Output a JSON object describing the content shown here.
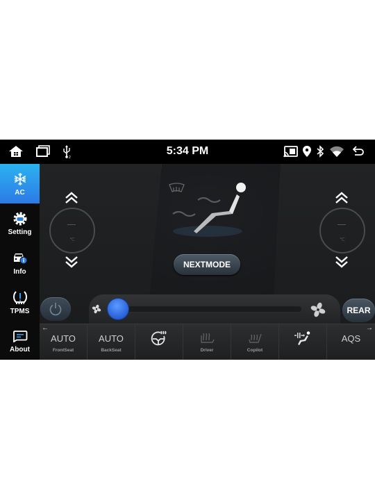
{
  "statusbar": {
    "time": "5:34 PM",
    "left_icons": [
      "home-icon",
      "recent-apps-icon",
      "usb-icon"
    ],
    "right_icons": [
      "cast-icon",
      "location-icon",
      "bluetooth-icon",
      "wifi-icon",
      "back-icon"
    ]
  },
  "sidebar": {
    "items": [
      {
        "label": "AC",
        "icon": "snowflake-icon",
        "active": true
      },
      {
        "label": "Setting",
        "icon": "gear-car-icon",
        "active": false
      },
      {
        "label": "Info",
        "icon": "car-info-icon",
        "active": false
      },
      {
        "label": "TPMS",
        "icon": "tire-pressure-icon",
        "active": false
      },
      {
        "label": "About",
        "icon": "about-icon",
        "active": false
      }
    ]
  },
  "climate": {
    "left_zone": {
      "temperature": "—",
      "unit": "℃"
    },
    "right_zone": {
      "temperature": "—",
      "unit": "℃"
    },
    "nextmode_label": "NEXTMODE",
    "rear_label": "REAR",
    "fan_level": 0,
    "accent_color": "#2c7ae6"
  },
  "bottombar": {
    "items": [
      {
        "main": "AUTO",
        "sub": "FrontSeat"
      },
      {
        "main": "AUTO",
        "sub": "BackSeat"
      },
      {
        "icon": "steering-wheel-heat-icon",
        "sub": ""
      },
      {
        "icon": "seat-heat-icon",
        "sub": "Driver"
      },
      {
        "icon": "seat-heat-icon",
        "sub": "Copilot"
      },
      {
        "icon": "seat-ventilation-icon",
        "sub": ""
      },
      {
        "main": "AQS",
        "sub": ""
      }
    ]
  }
}
